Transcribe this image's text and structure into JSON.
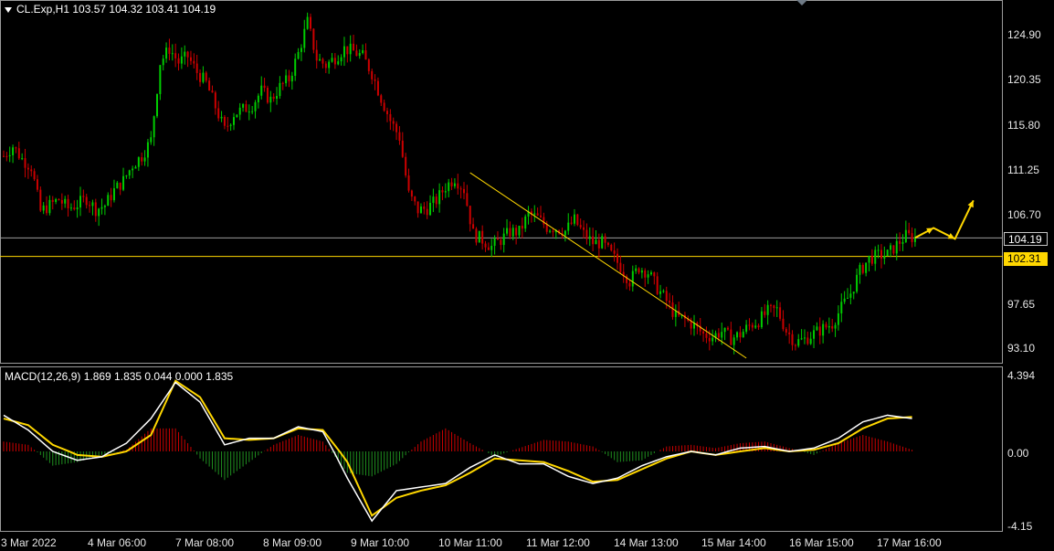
{
  "header": {
    "symbol_line": "CL.Exp,H1  103.57 104.32 103.41 104.19"
  },
  "macd_header": {
    "text": "MACD(12,26,9) 1.869 1.835 0.044 0.000 1.835"
  },
  "price_axis": {
    "ticks": [
      "124.90",
      "120.35",
      "115.80",
      "111.25",
      "106.70",
      "97.65",
      "93.10"
    ],
    "tick_values": [
      124.9,
      120.35,
      115.8,
      111.25,
      106.7,
      97.65,
      93.1
    ],
    "current_price": "104.19",
    "level_price": "102.31"
  },
  "macd_axis": {
    "ticks": [
      "4.394",
      "0.00",
      "-4.15"
    ]
  },
  "time_axis": {
    "labels": [
      "3 Mar 2022",
      "4 Mar 06:00",
      "7 Mar 08:00",
      "8 Mar 09:00",
      "9 Mar 10:00",
      "10 Mar 11:00",
      "11 Mar 12:00",
      "14 Mar 13:00",
      "15 Mar 14:00",
      "16 Mar 15:00",
      "17 Mar 16:00"
    ]
  },
  "colors": {
    "bull": "#00cc00",
    "bear": "#cc0000",
    "macd_line": "#ffffff",
    "signal_line": "#ffd700",
    "trendline": "#ffd700",
    "arrows": "#ffd700"
  },
  "chart_data": [
    {
      "type": "candlestick",
      "title": "CL.Exp,H1",
      "ylim": [
        92.0,
        128.0
      ],
      "close_series": [
        [
          0,
          112.5
        ],
        [
          3,
          113.5
        ],
        [
          6,
          112.2
        ],
        [
          9,
          111.4
        ],
        [
          12,
          106.9
        ],
        [
          15,
          107.5
        ],
        [
          18,
          108.1
        ],
        [
          21,
          107.2
        ],
        [
          24,
          107.6
        ],
        [
          27,
          108.2
        ],
        [
          30,
          107.1
        ],
        [
          33,
          107.5
        ],
        [
          36,
          109.0
        ],
        [
          39,
          110.0
        ],
        [
          42,
          111.6
        ],
        [
          45,
          112.5
        ],
        [
          48,
          114.1
        ],
        [
          51,
          122.0
        ],
        [
          54,
          123.4
        ],
        [
          57,
          122.0
        ],
        [
          60,
          122.6
        ],
        [
          63,
          121.0
        ],
        [
          66,
          119.9
        ],
        [
          69,
          117.5
        ],
        [
          72,
          115.1
        ],
        [
          75,
          116.8
        ],
        [
          78,
          117.2
        ],
        [
          81,
          117.7
        ],
        [
          84,
          119.1
        ],
        [
          87,
          118.2
        ],
        [
          90,
          119.5
        ],
        [
          93,
          120.3
        ],
        [
          96,
          122.9
        ],
        [
          99,
          126.1
        ],
        [
          102,
          122.4
        ],
        [
          105,
          121.7
        ],
        [
          108,
          122.5
        ],
        [
          111,
          123.4
        ],
        [
          114,
          123.1
        ],
        [
          117,
          122.6
        ],
        [
          120,
          120.9
        ],
        [
          123,
          118.4
        ],
        [
          126,
          116.1
        ],
        [
          129,
          114.4
        ],
        [
          132,
          108.6
        ],
        [
          135,
          107.0
        ],
        [
          138,
          107.2
        ],
        [
          141,
          108.0
        ],
        [
          144,
          109.4
        ],
        [
          147,
          110.3
        ],
        [
          150,
          109.1
        ],
        [
          153,
          104.6
        ],
        [
          156,
          104.0
        ],
        [
          159,
          103.3
        ],
        [
          162,
          104.0
        ],
        [
          165,
          104.8
        ],
        [
          168,
          104.8
        ],
        [
          171,
          106.6
        ],
        [
          174,
          106.2
        ],
        [
          177,
          105.3
        ],
        [
          180,
          105.2
        ],
        [
          183,
          104.9
        ],
        [
          186,
          106.0
        ],
        [
          189,
          104.6
        ],
        [
          192,
          103.7
        ],
        [
          195,
          103.7
        ],
        [
          198,
          102.5
        ],
        [
          201,
          101.3
        ],
        [
          204,
          99.8
        ],
        [
          207,
          101.2
        ],
        [
          210,
          100.7
        ],
        [
          213,
          99.1
        ],
        [
          216,
          97.8
        ],
        [
          219,
          96.2
        ],
        [
          222,
          95.9
        ],
        [
          225,
          95.3
        ],
        [
          228,
          94.4
        ],
        [
          231,
          94.2
        ],
        [
          234,
          94.7
        ],
        [
          237,
          94.0
        ],
        [
          240,
          94.4
        ],
        [
          243,
          95.3
        ],
        [
          246,
          95.8
        ],
        [
          249,
          96.7
        ],
        [
          252,
          96.9
        ],
        [
          255,
          94.8
        ],
        [
          258,
          93.6
        ],
        [
          261,
          93.9
        ],
        [
          264,
          94.5
        ],
        [
          267,
          95.0
        ],
        [
          270,
          95.5
        ],
        [
          273,
          97.1
        ],
        [
          276,
          98.6
        ],
        [
          279,
          100.8
        ],
        [
          282,
          102.1
        ],
        [
          285,
          102.4
        ],
        [
          288,
          102.5
        ],
        [
          291,
          103.5
        ],
        [
          294,
          104.4
        ],
        [
          297,
          104.2
        ]
      ],
      "trendline": {
        "x": [
          152,
          242
        ],
        "y": [
          110.8,
          92.0
        ]
      },
      "horizontal_levels": [
        104.19,
        102.31
      ],
      "projection_arrows": [
        [
          297,
          104.2
        ],
        [
          303,
          105.2
        ],
        [
          310,
          104.1
        ],
        [
          316,
          108.0
        ]
      ]
    },
    {
      "type": "histogram+line",
      "title": "MACD(12,26,9)",
      "ylim": [
        -4.15,
        4.394
      ],
      "x": [
        0,
        8,
        16,
        24,
        32,
        40,
        48,
        56,
        64,
        72,
        80,
        88,
        96,
        104,
        112,
        120,
        128,
        136,
        144,
        152,
        160,
        168,
        176,
        184,
        192,
        200,
        208,
        216,
        224,
        232,
        240,
        248,
        256,
        264,
        272,
        280,
        288,
        296
      ],
      "macd": [
        2.2,
        1.3,
        0.0,
        -0.5,
        -0.3,
        0.5,
        2.0,
        4.2,
        3.0,
        0.4,
        0.8,
        0.8,
        1.5,
        1.2,
        -1.5,
        -3.9,
        -2.2,
        -2.0,
        -1.8,
        -0.9,
        -0.2,
        -0.7,
        -0.7,
        -1.4,
        -1.8,
        -1.5,
        -0.8,
        -0.3,
        0.0,
        -0.2,
        0.2,
        0.3,
        0.0,
        0.2,
        0.8,
        1.8,
        2.2,
        2.0
      ],
      "signal": [
        2.0,
        1.6,
        0.4,
        -0.2,
        -0.3,
        0.0,
        1.0,
        4.3,
        3.3,
        0.8,
        0.7,
        0.8,
        1.4,
        1.3,
        -0.6,
        -3.6,
        -2.6,
        -2.2,
        -1.9,
        -1.2,
        -0.4,
        -0.5,
        -0.6,
        -1.1,
        -1.7,
        -1.6,
        -1.0,
        -0.4,
        0.0,
        -0.2,
        0.0,
        0.2,
        0.0,
        0.1,
        0.5,
        1.4,
        2.0,
        2.1
      ],
      "histogram": [
        0.6,
        0.4,
        -0.8,
        -0.6,
        -0.2,
        0.1,
        1.4,
        1.4,
        -0.4,
        -1.6,
        -0.6,
        0.4,
        1.0,
        0.6,
        -1.2,
        -1.4,
        -0.7,
        0.6,
        1.4,
        0.5,
        -0.3,
        0.2,
        0.7,
        0.6,
        0.3,
        -0.6,
        -0.5,
        0.3,
        0.4,
        0.2,
        0.5,
        0.6,
        0.2,
        -0.2,
        0.5,
        1.0,
        0.6,
        0.1
      ]
    }
  ]
}
